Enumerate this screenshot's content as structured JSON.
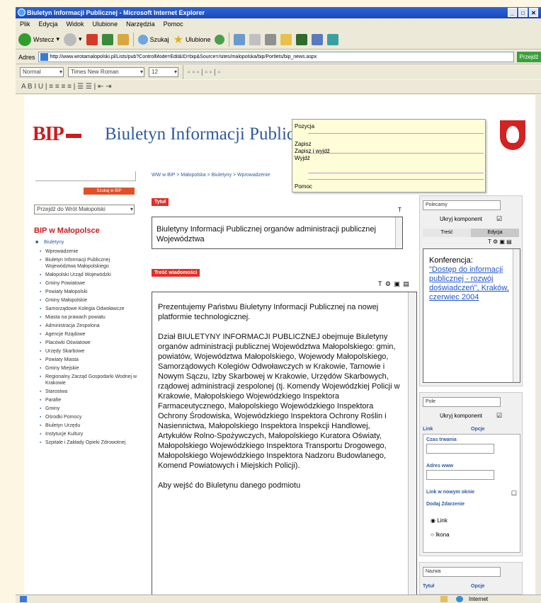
{
  "window": {
    "title": "Biuletyn Informacji Publicznej - Microsoft Internet Explorer",
    "buttons": [
      "_",
      "□",
      "✕"
    ]
  },
  "menu": [
    "Plik",
    "Edycja",
    "Widok",
    "Ulubione",
    "Narzędzia",
    "Pomoc"
  ],
  "toolbar": {
    "back": "Wstecz",
    "search": "Szukaj",
    "favorites": "Ulubione"
  },
  "address": {
    "label": "Adres",
    "url": "http://www.wrotamalopolski.pl/Lists/pub?ControlMode=Edit&ID=bip&Source=/sites/malopolska/bip/Portlets/bip_news.aspx",
    "go": "Przejdź"
  },
  "format": {
    "style": "Normal",
    "font": "Times New Roman",
    "size": "12",
    "buttons": "A  B  I  U  |  ≡ ≡ ≡ ≡  |  ☰ ☰  |  ⇤ ⇥"
  },
  "page": {
    "logo": "BIP",
    "title": "Biuletyn Informacji Publicznej",
    "popup": {
      "title": "Pozycja",
      "items": [
        "Zapisz",
        "Zapisz i wyjdź",
        "Wyjdź"
      ],
      "help": "Pomoc"
    },
    "left": {
      "search_button": "Szukaj w BIP",
      "select": "Przejdź do Wrót Małopolski",
      "heading": "BIP w Małopolsce",
      "root": "Biuletyny",
      "items": [
        "Wprowadzenie",
        "Biuletyn Informacji Publicznej Województwa Małopolskiego",
        "Małopolski Urząd Wojewódzki",
        "Gminy Powiatowe",
        "Powiaty Małopolski",
        "Gminy Małopolskie",
        "Samorządowe Kolegia Odwoławcze",
        "Miasta na prawach powiatu",
        "Administracja Zespolona",
        "Agencje Rządowe",
        "Placówki Oświatowe",
        "Urzędy Skarbowe",
        "Powiaty Miasta",
        "Gminy Miejskie",
        "Regionalny Zarząd Gospodarki Wodnej w Krakowie",
        "Starostwa",
        "Parafie",
        "Gminy",
        "Ośrodki Pomocy",
        "Biuletyn Urzędu",
        "Instytucje Kultury",
        "Szpitale i Zakłady Opieki Zdrowotnej"
      ]
    },
    "breadcrumb": "WW w BIP > Małopolska > Biuletyny > Wprowadzenie",
    "center": {
      "label1": "Tytuł",
      "text1": "Biuletyny Informacji Publicznej organów administracji publicznej Województwa",
      "label2": "Treść wiadomości",
      "para1": "Prezentujemy Państwu Biuletyny Informacji Publicznej na nowej platformie technologicznej.",
      "para2": "Dział BIULETYNY INFORMACJI PUBLICZNEJ obejmuje Biuletyny organów administracji publicznej Województwa Małopolskiego: gmin, powiatów, Województwa Małopolskiego, Wojewody Małopolskiego, Samorządowych Kolegiów Odwoławczych w Krakowie, Tarnowie i Nowym Sączu, Izby Skarbowej w Krakowie, Urzędów Skarbowych, rządowej administracji zespolonej (tj. Komendy Wojewódzkiej Policji w Krakowie, Małopolskiego Wojewódzkiego Inspektora Farmaceutycznego, Małopolskiego Wojewódzkiego Inspektora Ochrony Środowiska, Wojewódzkiego Inspektora Ochrony Roślin i Nasiennictwa, Małopolskiego Inspektora Inspekcji Handlowej, Artykułów Rolno-Spożywczych, Małopolskiego Kuratora Oświaty, Małopolskiego Wojewódzkiego Inspektora Transportu Drogowego, Małopolskiego Wojewódzkiego Inspektora Nadzoru Budowlanego, Komend Powiatowych i Miejskich Policji).",
      "para3": "Aby wejść do Biuletynu danego podmiotu"
    },
    "right": {
      "box1_input": "Polecamy",
      "box1_label": "Ukryj komponent",
      "tabs": [
        "Treść",
        "Edycja"
      ],
      "box1_text": "Konferencja:",
      "box1_link": "\"Dostęp do informacji publicznej - rozwój doświadczeń\", Kraków, czerwiec 2004",
      "box2_input": "Pole",
      "box2_label": "Ukryj komponent",
      "tabs2": [
        "Link",
        "Opcje"
      ],
      "field1": "Czas trwania",
      "field2": "Adres www",
      "check": "Link w nowym oknie",
      "radio_label": "Dodaj Zdarzenie",
      "radio1": "Link",
      "radio2": "Ikona",
      "box3_input": "Nazwa",
      "box3_tabs": [
        "Tytuł",
        "Opcje"
      ]
    }
  },
  "status": {
    "zone": "Internet"
  }
}
